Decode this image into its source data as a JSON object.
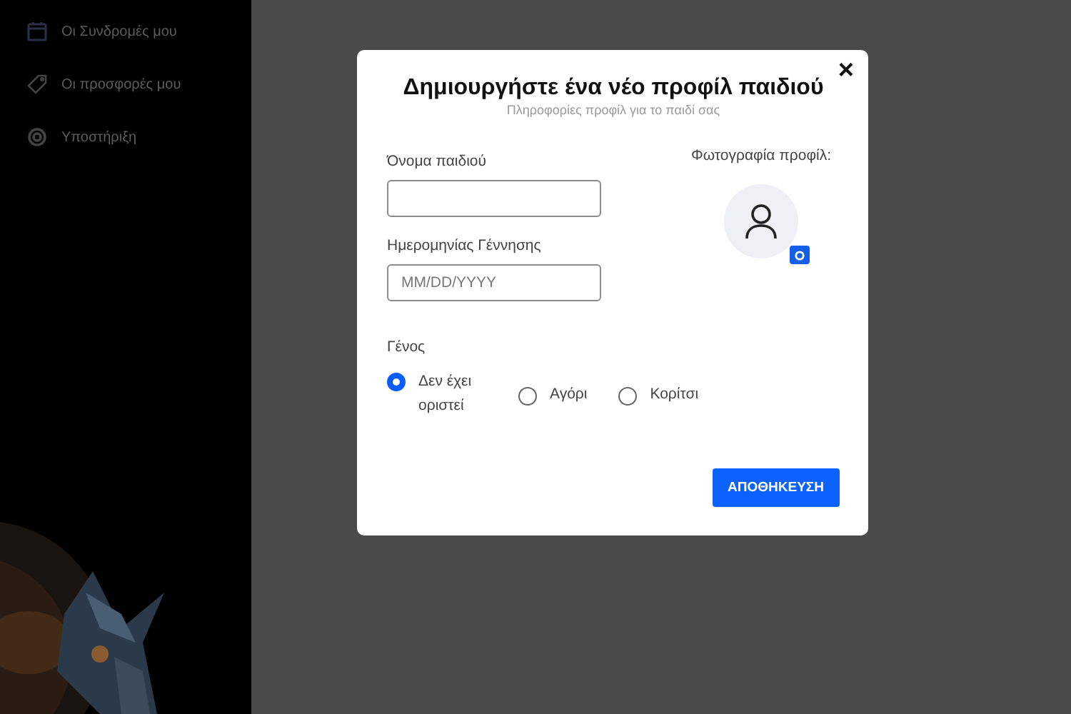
{
  "sidebar": {
    "items": [
      {
        "label": "Οι Συνδρομές μου"
      },
      {
        "label": "Οι προσφορές μου"
      },
      {
        "label": "Υποστήριξη"
      }
    ]
  },
  "dialog": {
    "title": "Δημιουργήστε ένα νέο προφίλ παιδιού",
    "subtitle": "Πληροφορίες προφίλ για το παιδί σας",
    "close": "×",
    "fields": [
      {
        "label": "Όνομα παιδιού"
      },
      {
        "label": "Ημερομηνίας Γέννησης",
        "placeholder": "MM/DD/YYYY"
      }
    ],
    "photo": {
      "label": "Φωτογραφία προφίλ:"
    },
    "gender": {
      "label": "Γένος",
      "options": [
        {
          "label": "Δεν έχει οριστεί",
          "selected": true
        },
        {
          "label": "Αγόρι",
          "selected": false
        },
        {
          "label": "Κορίτσι",
          "selected": false
        }
      ]
    },
    "save_button": "ΑΠΟΘΗΚΕΥΣΗ"
  }
}
